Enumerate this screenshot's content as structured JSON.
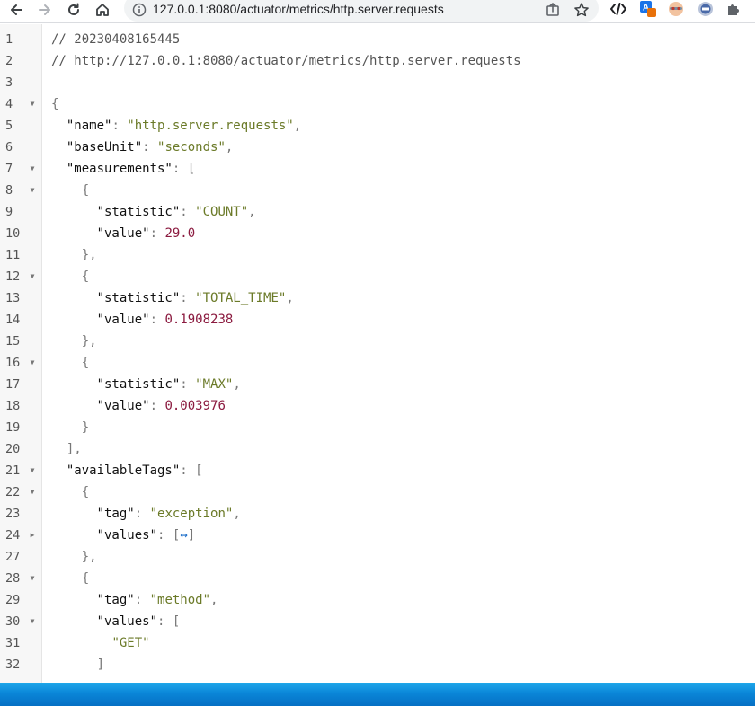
{
  "browser": {
    "url": "127.0.0.1:8080/actuator/metrics/http.server.requests",
    "back_icon": "arrow-left-icon",
    "forward_icon": "arrow-right-icon",
    "reload_icon": "reload-icon",
    "home_icon": "home-icon",
    "site_info_icon": "info-icon",
    "share_icon": "share-icon",
    "bookmark_icon": "star-icon",
    "extensions": [
      "code-view-extension-icon",
      "translate-extension-icon",
      "profile-extension-icon",
      "globe-extension-icon",
      "puzzle-extensions-icon"
    ]
  },
  "json_viewer": {
    "lines": [
      {
        "n": "1",
        "fold": "",
        "tokens": [
          {
            "t": "comment",
            "v": "// 20230408165445"
          }
        ]
      },
      {
        "n": "2",
        "fold": "",
        "tokens": [
          {
            "t": "comment",
            "v": "// http://127.0.0.1:8080/actuator/metrics/http.server.requests"
          }
        ]
      },
      {
        "n": "3",
        "fold": "",
        "tokens": []
      },
      {
        "n": "4",
        "fold": "open",
        "tokens": [
          {
            "t": "punc",
            "v": "{"
          }
        ]
      },
      {
        "n": "5",
        "fold": "",
        "tokens": [
          {
            "t": "indent",
            "v": "  "
          },
          {
            "t": "key",
            "v": "\"name\""
          },
          {
            "t": "punc",
            "v": ": "
          },
          {
            "t": "str",
            "v": "\"http.server.requests\""
          },
          {
            "t": "punc",
            "v": ","
          }
        ]
      },
      {
        "n": "6",
        "fold": "",
        "tokens": [
          {
            "t": "indent",
            "v": "  "
          },
          {
            "t": "key",
            "v": "\"baseUnit\""
          },
          {
            "t": "punc",
            "v": ": "
          },
          {
            "t": "str",
            "v": "\"seconds\""
          },
          {
            "t": "punc",
            "v": ","
          }
        ]
      },
      {
        "n": "7",
        "fold": "open",
        "tokens": [
          {
            "t": "indent",
            "v": "  "
          },
          {
            "t": "key",
            "v": "\"measurements\""
          },
          {
            "t": "punc",
            "v": ": ["
          }
        ]
      },
      {
        "n": "8",
        "fold": "open",
        "tokens": [
          {
            "t": "indent",
            "v": "    "
          },
          {
            "t": "punc",
            "v": "{"
          }
        ]
      },
      {
        "n": "9",
        "fold": "",
        "tokens": [
          {
            "t": "indent",
            "v": "      "
          },
          {
            "t": "key",
            "v": "\"statistic\""
          },
          {
            "t": "punc",
            "v": ": "
          },
          {
            "t": "str",
            "v": "\"COUNT\""
          },
          {
            "t": "punc",
            "v": ","
          }
        ]
      },
      {
        "n": "10",
        "fold": "",
        "tokens": [
          {
            "t": "indent",
            "v": "      "
          },
          {
            "t": "key",
            "v": "\"value\""
          },
          {
            "t": "punc",
            "v": ": "
          },
          {
            "t": "num",
            "v": "29.0"
          }
        ]
      },
      {
        "n": "11",
        "fold": "",
        "tokens": [
          {
            "t": "indent",
            "v": "    "
          },
          {
            "t": "punc",
            "v": "},"
          }
        ]
      },
      {
        "n": "12",
        "fold": "open",
        "tokens": [
          {
            "t": "indent",
            "v": "    "
          },
          {
            "t": "punc",
            "v": "{"
          }
        ]
      },
      {
        "n": "13",
        "fold": "",
        "tokens": [
          {
            "t": "indent",
            "v": "      "
          },
          {
            "t": "key",
            "v": "\"statistic\""
          },
          {
            "t": "punc",
            "v": ": "
          },
          {
            "t": "str",
            "v": "\"TOTAL_TIME\""
          },
          {
            "t": "punc",
            "v": ","
          }
        ]
      },
      {
        "n": "14",
        "fold": "",
        "tokens": [
          {
            "t": "indent",
            "v": "      "
          },
          {
            "t": "key",
            "v": "\"value\""
          },
          {
            "t": "punc",
            "v": ": "
          },
          {
            "t": "num",
            "v": "0.1908238"
          }
        ]
      },
      {
        "n": "15",
        "fold": "",
        "tokens": [
          {
            "t": "indent",
            "v": "    "
          },
          {
            "t": "punc",
            "v": "},"
          }
        ]
      },
      {
        "n": "16",
        "fold": "open",
        "tokens": [
          {
            "t": "indent",
            "v": "    "
          },
          {
            "t": "punc",
            "v": "{"
          }
        ]
      },
      {
        "n": "17",
        "fold": "",
        "tokens": [
          {
            "t": "indent",
            "v": "      "
          },
          {
            "t": "key",
            "v": "\"statistic\""
          },
          {
            "t": "punc",
            "v": ": "
          },
          {
            "t": "str",
            "v": "\"MAX\""
          },
          {
            "t": "punc",
            "v": ","
          }
        ]
      },
      {
        "n": "18",
        "fold": "",
        "tokens": [
          {
            "t": "indent",
            "v": "      "
          },
          {
            "t": "key",
            "v": "\"value\""
          },
          {
            "t": "punc",
            "v": ": "
          },
          {
            "t": "num",
            "v": "0.003976"
          }
        ]
      },
      {
        "n": "19",
        "fold": "",
        "tokens": [
          {
            "t": "indent",
            "v": "    "
          },
          {
            "t": "punc",
            "v": "}"
          }
        ]
      },
      {
        "n": "20",
        "fold": "",
        "tokens": [
          {
            "t": "indent",
            "v": "  "
          },
          {
            "t": "punc",
            "v": "],"
          }
        ]
      },
      {
        "n": "21",
        "fold": "open",
        "tokens": [
          {
            "t": "indent",
            "v": "  "
          },
          {
            "t": "key",
            "v": "\"availableTags\""
          },
          {
            "t": "punc",
            "v": ": ["
          }
        ]
      },
      {
        "n": "22",
        "fold": "open",
        "tokens": [
          {
            "t": "indent",
            "v": "    "
          },
          {
            "t": "punc",
            "v": "{"
          }
        ]
      },
      {
        "n": "23",
        "fold": "",
        "tokens": [
          {
            "t": "indent",
            "v": "      "
          },
          {
            "t": "key",
            "v": "\"tag\""
          },
          {
            "t": "punc",
            "v": ": "
          },
          {
            "t": "str",
            "v": "\"exception\""
          },
          {
            "t": "punc",
            "v": ","
          }
        ]
      },
      {
        "n": "24",
        "fold": "closed",
        "tokens": [
          {
            "t": "indent",
            "v": "      "
          },
          {
            "t": "key",
            "v": "\"values\""
          },
          {
            "t": "punc",
            "v": ": ["
          },
          {
            "t": "coll",
            "v": "↔"
          },
          {
            "t": "punc",
            "v": "]"
          }
        ]
      },
      {
        "n": "27",
        "fold": "",
        "tokens": [
          {
            "t": "indent",
            "v": "    "
          },
          {
            "t": "punc",
            "v": "},"
          }
        ]
      },
      {
        "n": "28",
        "fold": "open",
        "tokens": [
          {
            "t": "indent",
            "v": "    "
          },
          {
            "t": "punc",
            "v": "{"
          }
        ]
      },
      {
        "n": "29",
        "fold": "",
        "tokens": [
          {
            "t": "indent",
            "v": "      "
          },
          {
            "t": "key",
            "v": "\"tag\""
          },
          {
            "t": "punc",
            "v": ": "
          },
          {
            "t": "str",
            "v": "\"method\""
          },
          {
            "t": "punc",
            "v": ","
          }
        ]
      },
      {
        "n": "30",
        "fold": "open",
        "tokens": [
          {
            "t": "indent",
            "v": "      "
          },
          {
            "t": "key",
            "v": "\"values\""
          },
          {
            "t": "punc",
            "v": ": ["
          }
        ]
      },
      {
        "n": "31",
        "fold": "",
        "tokens": [
          {
            "t": "indent",
            "v": "        "
          },
          {
            "t": "str",
            "v": "\"GET\""
          }
        ]
      },
      {
        "n": "32",
        "fold": "",
        "tokens": [
          {
            "t": "indent",
            "v": "      "
          },
          {
            "t": "punc",
            "v": "]"
          }
        ]
      }
    ]
  }
}
